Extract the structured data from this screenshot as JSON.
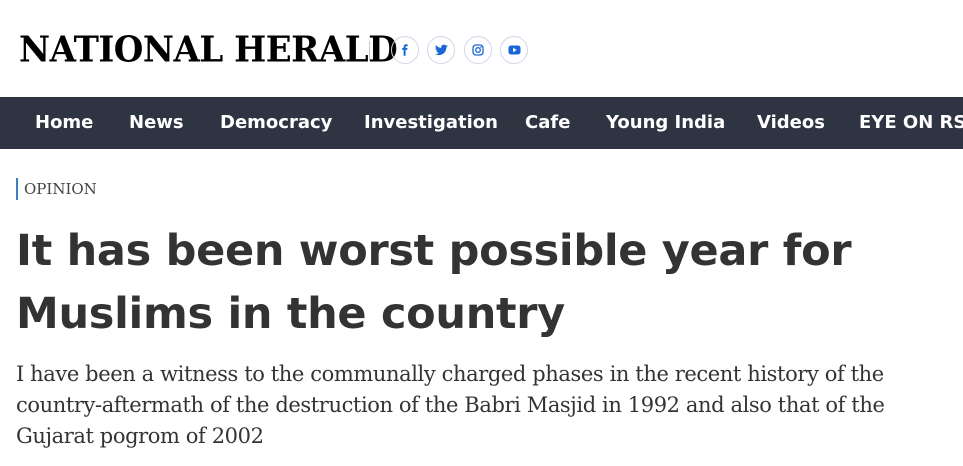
{
  "header": {
    "logo_text": "NATIONAL HERALD",
    "social": [
      {
        "icon": "facebook-icon",
        "label": "f"
      },
      {
        "icon": "twitter-icon",
        "label": "twitter"
      },
      {
        "icon": "instagram-icon",
        "label": "instagram"
      },
      {
        "icon": "youtube-icon",
        "label": "youtube"
      }
    ],
    "social_icon_color": "#1a66d6"
  },
  "nav": {
    "items": [
      "Home",
      "News",
      "Democracy",
      "Investigation",
      "Cafe",
      "Young India",
      "Videos",
      "EYE ON RSS"
    ],
    "background": "#2e3442"
  },
  "article": {
    "category": "OPINION",
    "category_accent": "#3d7fc1",
    "headline": "It has been worst possible year for Muslims in the country",
    "subheadline": "I have been a witness to the communally charged phases in the recent history of the country-aftermath of the destruction of the Babri Masjid in 1992 and also that of the Gujarat pogrom of 2002"
  }
}
